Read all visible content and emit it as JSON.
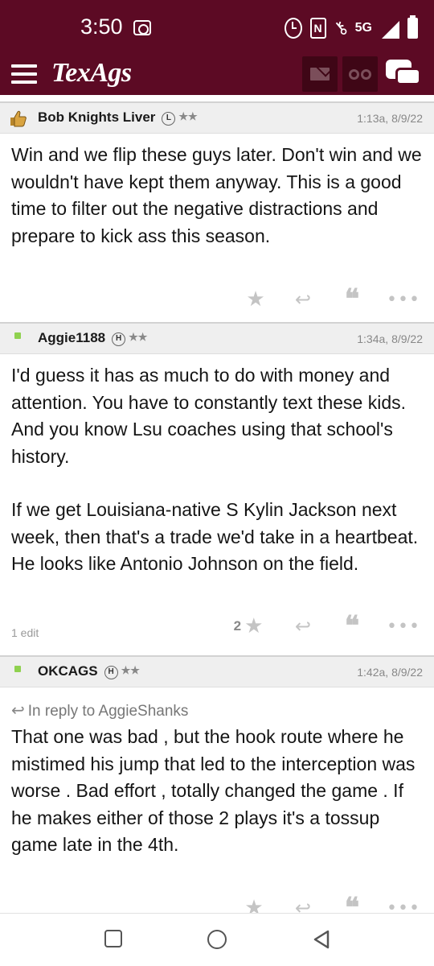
{
  "status_bar": {
    "time": "3:50",
    "network": "5G",
    "icons": [
      "screen-record-icon",
      "alarm-icon",
      "nfc-icon",
      "key-icon",
      "signal-icon",
      "battery-icon"
    ]
  },
  "app_bar": {
    "logo": "TexAgs",
    "brand_color": "#5c0a24",
    "icons": [
      "menu-icon",
      "mail-icon",
      "binoculars-icon",
      "chat-icon"
    ]
  },
  "posts": [
    {
      "username": "Bob Knights Liver",
      "badge": "L",
      "stars": "★★",
      "time": "1:13a, 8/9/22",
      "avatar_icon": "thumbs-up-hand-icon",
      "reply_to": null,
      "paragraphs": [
        "Win and we flip these guys later. Don't win and we wouldn't have kept them anyway. This is a good time to filter out the negative distractions and prepare to kick ass this season."
      ],
      "star_count": "",
      "edit_note": ""
    },
    {
      "username": "Aggie1188",
      "badge": "H",
      "stars": "★★",
      "time": "1:34a, 8/9/22",
      "avatar_icon": "phone-icon",
      "reply_to": null,
      "paragraphs": [
        "I'd guess it has as much to do with money and attention. You have to constantly text these kids. And you know Lsu coaches using that school's history.",
        "If we get Louisiana-native S Kylin Jackson next week, then that's a trade we'd take in a heartbeat. He looks like Antonio Johnson on the field."
      ],
      "star_count": "2",
      "edit_note": "1 edit"
    },
    {
      "username": "OKCAGS",
      "badge": "H",
      "stars": "★★",
      "time": "1:42a, 8/9/22",
      "avatar_icon": "phone-icon",
      "reply_to": "In reply to AggieShanks",
      "paragraphs": [
        "That one was bad , but the hook route where he mistimed his jump that led to the interception was worse . Bad effort , totally changed the game . If he makes either of those 2 plays it's a tossup game late in the 4th."
      ],
      "star_count": "",
      "edit_note": ""
    }
  ],
  "nav_bar": {
    "icons": [
      "recent-apps-icon",
      "home-icon",
      "back-icon"
    ]
  }
}
